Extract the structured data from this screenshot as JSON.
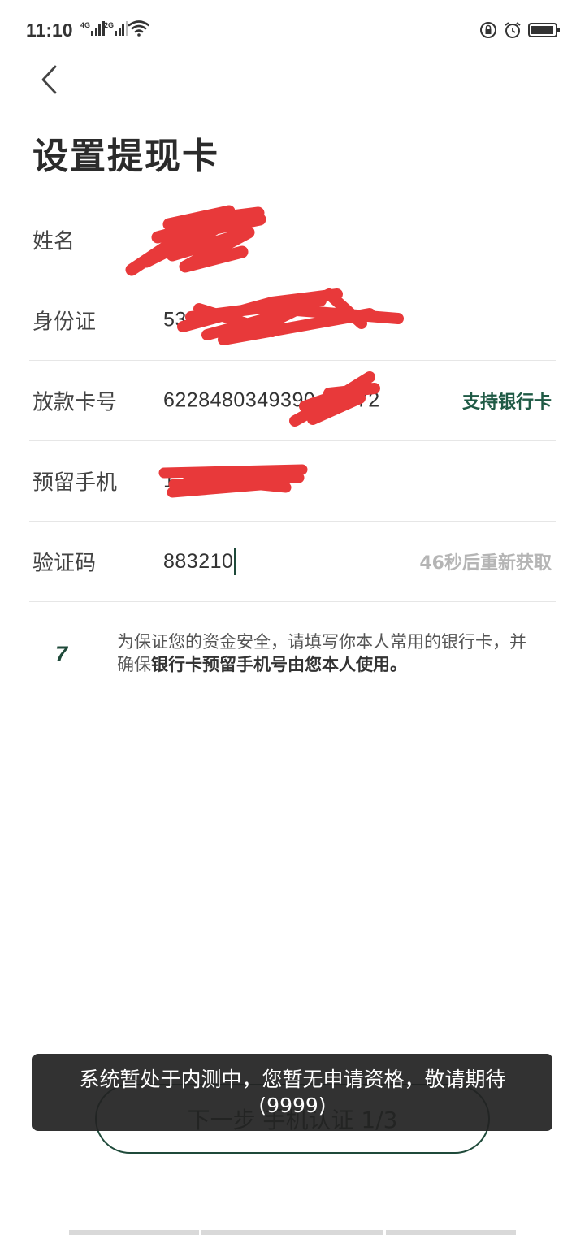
{
  "status_bar": {
    "time": "11:10",
    "sim1_tag": "4G",
    "sim2_tag": "2G",
    "icons": [
      "signal-4g-icon",
      "signal-2g-icon",
      "wifi-icon",
      "rotation-lock-icon",
      "alarm-icon",
      "battery-icon"
    ]
  },
  "header": {
    "back_icon": "chevron-left-icon",
    "title": "设置提现卡"
  },
  "form": {
    "name": {
      "label": "姓名",
      "value": ""
    },
    "id_card": {
      "label": "身份证",
      "value": "53"
    },
    "card_number": {
      "label": "放款卡号",
      "value": "6228480349390 93472",
      "action": "支持银行卡"
    },
    "phone": {
      "label": "预留手机",
      "value": "1"
    },
    "code": {
      "label": "验证码",
      "value": "883210",
      "action": "46秒后重新获取"
    }
  },
  "tip": {
    "icon": "7",
    "text_normal": "为保证您的资金安全，请填写你本人常用的银行卡，并确保",
    "text_bold": "银行卡预留手机号由您本人使用。"
  },
  "next_button": {
    "label": "下一步 手机认证 1/3"
  },
  "toast": {
    "message": "系统暂处于内测中，您暂无申请资格，敬请期待(9999)"
  },
  "colors": {
    "accent": "#1f4a3a",
    "support_link": "#1f5a45",
    "countdown": "#b5b5b5",
    "redaction": "#e8393a"
  }
}
